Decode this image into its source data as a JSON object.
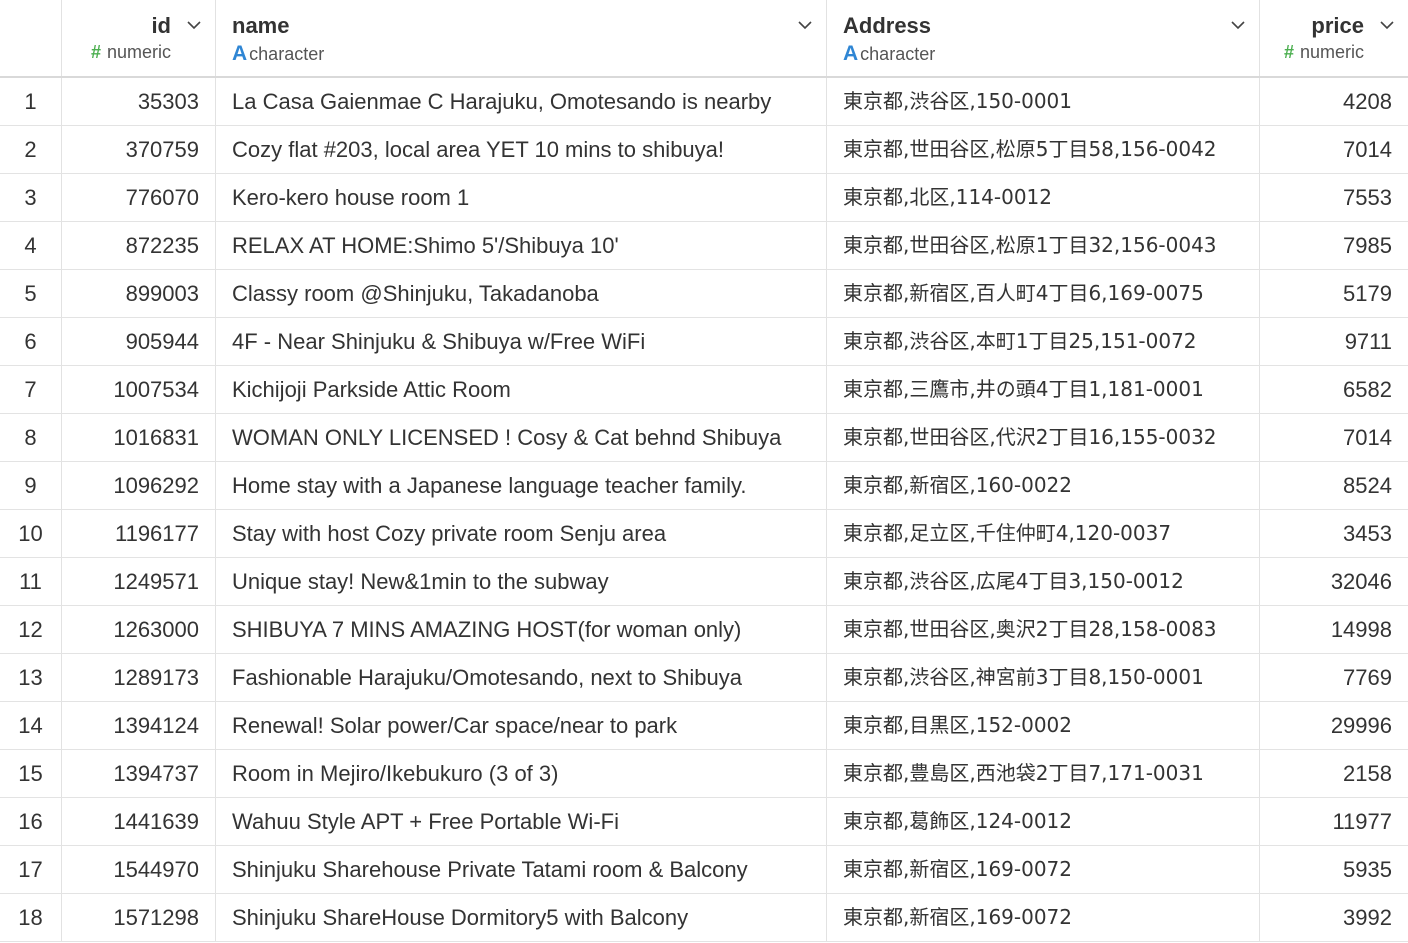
{
  "columns": [
    {
      "name": "id",
      "type": "numeric",
      "type_icon": "#",
      "align": "right"
    },
    {
      "name": "name",
      "type": "character",
      "type_icon": "A",
      "align": "left"
    },
    {
      "name": "Address",
      "type": "character",
      "type_icon": "A",
      "align": "left"
    },
    {
      "name": "price",
      "type": "numeric",
      "type_icon": "#",
      "align": "right"
    }
  ],
  "rows": [
    {
      "n": "1",
      "id": "35303",
      "name": "La Casa Gaienmae C Harajuku, Omotesando is nearby",
      "address": "東京都,渋谷区,150-0001",
      "price": "4208"
    },
    {
      "n": "2",
      "id": "370759",
      "name": "Cozy flat #203, local area YET 10 mins to shibuya!",
      "address": "東京都,世田谷区,松原5丁目58,156-0042",
      "price": "7014"
    },
    {
      "n": "3",
      "id": "776070",
      "name": "Kero-kero house room 1",
      "address": "東京都,北区,114-0012",
      "price": "7553"
    },
    {
      "n": "4",
      "id": "872235",
      "name": "RELAX AT HOME:Shimo 5'/Shibuya 10'",
      "address": "東京都,世田谷区,松原1丁目32,156-0043",
      "price": "7985"
    },
    {
      "n": "5",
      "id": "899003",
      "name": "Classy room @Shinjuku, Takadanoba",
      "address": "東京都,新宿区,百人町4丁目6,169-0075",
      "price": "5179"
    },
    {
      "n": "6",
      "id": "905944",
      "name": "4F - Near Shinjuku & Shibuya w/Free WiFi",
      "address": "東京都,渋谷区,本町1丁目25,151-0072",
      "price": "9711"
    },
    {
      "n": "7",
      "id": "1007534",
      "name": "Kichijoji Parkside Attic Room",
      "address": "東京都,三鷹市,井の頭4丁目1,181-0001",
      "price": "6582"
    },
    {
      "n": "8",
      "id": "1016831",
      "name": "WOMAN ONLY LICENSED ! Cosy & Cat behnd Shibuya",
      "address": "東京都,世田谷区,代沢2丁目16,155-0032",
      "price": "7014"
    },
    {
      "n": "9",
      "id": "1096292",
      "name": "Home stay with a Japanese language teacher family.",
      "address": "東京都,新宿区,160-0022",
      "price": "8524"
    },
    {
      "n": "10",
      "id": "1196177",
      "name": "Stay with host Cozy private room Senju area",
      "address": "東京都,足立区,千住仲町4,120-0037",
      "price": "3453"
    },
    {
      "n": "11",
      "id": "1249571",
      "name": "Unique stay! New&1min to the subway",
      "address": "東京都,渋谷区,広尾4丁目3,150-0012",
      "price": "32046"
    },
    {
      "n": "12",
      "id": "1263000",
      "name": "SHIBUYA 7 MINS AMAZING HOST(for woman only)",
      "address": "東京都,世田谷区,奥沢2丁目28,158-0083",
      "price": "14998"
    },
    {
      "n": "13",
      "id": "1289173",
      "name": "Fashionable Harajuku/Omotesando, next to Shibuya",
      "address": "東京都,渋谷区,神宮前3丁目8,150-0001",
      "price": "7769"
    },
    {
      "n": "14",
      "id": "1394124",
      "name": "Renewal! Solar power/Car space/near to park",
      "address": "東京都,目黒区,152-0002",
      "price": "29996"
    },
    {
      "n": "15",
      "id": "1394737",
      "name": "Room in Mejiro/Ikebukuro (3 of 3)",
      "address": "東京都,豊島区,西池袋2丁目7,171-0031",
      "price": "2158"
    },
    {
      "n": "16",
      "id": "1441639",
      "name": "Wahuu Style APT + Free Portable Wi-Fi",
      "address": "東京都,葛飾区,124-0012",
      "price": "11977"
    },
    {
      "n": "17",
      "id": "1544970",
      "name": "Shinjuku Sharehouse Private Tatami room & Balcony",
      "address": "東京都,新宿区,169-0072",
      "price": "5935"
    },
    {
      "n": "18",
      "id": "1571298",
      "name": "Shinjuku ShareHouse Dormitory5 with Balcony",
      "address": "東京都,新宿区,169-0072",
      "price": "3992"
    }
  ]
}
